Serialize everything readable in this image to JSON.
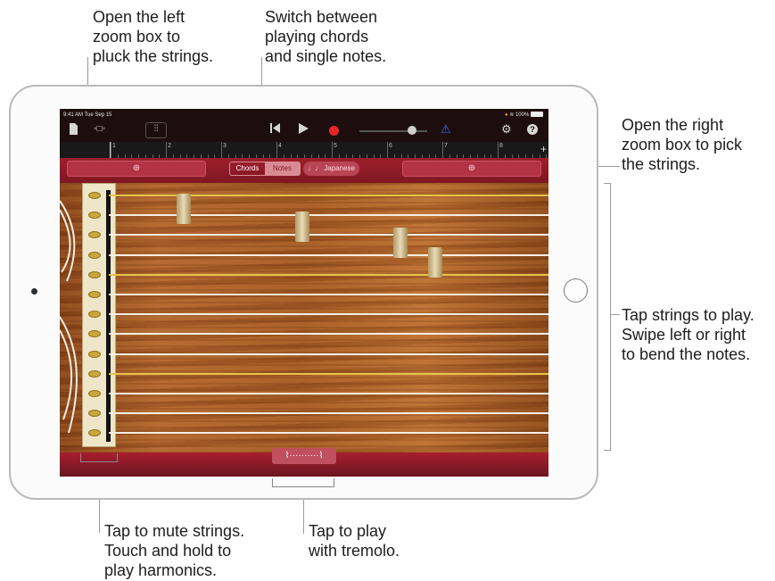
{
  "callouts": {
    "left_zoom": [
      "Open the left",
      "zoom box to",
      "pluck the strings."
    ],
    "chords_notes": [
      "Switch between",
      "playing chords",
      "and single notes."
    ],
    "right_zoom": [
      "Open the right",
      "zoom box to pick",
      "the strings."
    ],
    "tap_strings": [
      "Tap strings to play.",
      "Swipe left or right",
      "to bend the notes."
    ],
    "mute": [
      "Tap to mute strings.",
      "Touch and hold to",
      "play harmonics."
    ],
    "tremolo": [
      "Tap to play",
      "with tremolo."
    ]
  },
  "status_bar": {
    "time_date": "9:41 AM  Tue Sep 15",
    "battery": "100%"
  },
  "ruler_numbers": [
    "1",
    "2",
    "3",
    "4",
    "5",
    "6",
    "7",
    "8"
  ],
  "toolbar": {
    "file_icon": "document-icon",
    "browser_icon": "view-toggle-icon",
    "mixer_icon": "mixer-sliders-icon",
    "rewind_icon": "go-to-start-icon",
    "play_icon": "play-icon",
    "record_icon": "record-icon",
    "metronome_icon": "metronome-icon",
    "settings_icon": "settings-icon",
    "help_icon": "help-icon",
    "add_icon": "plus-icon"
  },
  "controls": {
    "chords_label": "Chords",
    "notes_label": "Notes",
    "scale_label": "Japanese",
    "selected_mode": "Notes",
    "left_zoom_icon": "zoom-magnifier-icon",
    "right_zoom_icon": "zoom-magnifier-icon"
  },
  "koto": {
    "string_count": 13,
    "tremolo_icon": "tremolo-icon"
  },
  "colors": {
    "accent_red": "#9e1e2c",
    "record_red": "#e8262a",
    "metronome_blue": "#3b6cff"
  }
}
